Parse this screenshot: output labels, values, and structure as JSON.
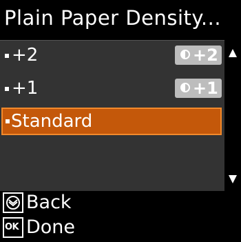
{
  "screen": {
    "title": "Plain Paper Density..."
  },
  "list": {
    "items": [
      {
        "label": "+2",
        "badge": "+2",
        "badge_icon": "density-icon",
        "selected": false
      },
      {
        "label": "+1",
        "badge": "+1",
        "badge_icon": "density-icon",
        "selected": false
      },
      {
        "label": "Standard",
        "badge": "",
        "selected": true
      }
    ],
    "scroll_up_icon": "arrow-up-icon",
    "scroll_down_icon": "arrow-down-icon"
  },
  "softkeys": {
    "back": {
      "label": "Back",
      "icon": "stop-button-icon"
    },
    "done": {
      "label": "Done",
      "icon": "ok-button-icon",
      "icon_text": "OK"
    }
  },
  "colors": {
    "background": "#000000",
    "list_background": "#333333",
    "selection": "#c4580a",
    "selection_border": "#f28a2c",
    "badge": "#bdbdbd"
  }
}
